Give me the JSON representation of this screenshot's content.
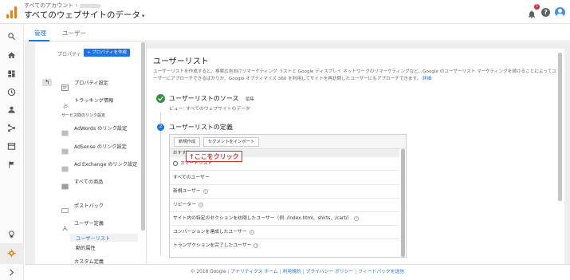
{
  "header": {
    "breadcrumb": "すべてのアカウント ›",
    "site_title": "すべてのウェブサイトのデータ",
    "caret": "▾",
    "notification_count": "1",
    "help_label": "?"
  },
  "tabs": [
    {
      "label": "管理"
    },
    {
      "label": "ユーザー"
    }
  ],
  "nav": {
    "property_label": "プロパティ",
    "create_property": "+ プロパティを作成",
    "back_label": "↰",
    "items": [
      {
        "label": "プロパティ設定"
      },
      {
        "label": "トラッキング情報"
      }
    ],
    "section_label": "サービス間のリンク設定",
    "links": [
      {
        "label": "AdWords のリンク設定"
      },
      {
        "label": "AdSense のリンク設定"
      },
      {
        "label": "Ad Exchange のリンク設定"
      },
      {
        "label": "すべての商品"
      },
      {
        "label": "ポストバック"
      },
      {
        "label": "ユーザー定義"
      }
    ],
    "sub_items": [
      {
        "label": "ユーザーリスト"
      },
      {
        "label": "動的属性"
      }
    ],
    "partial_item": "カスタム定義"
  },
  "main": {
    "title": "ユーザーリスト",
    "description": "ユーザーリストを作成すると、検索広告向けリマーケティング リストと Google ディスプレイ ネットワークのリマーケティングなど、Google のユーザーリスト マーケティングを続けることによってユーザーにアプローチできるばかりか、Google オプティマイズ 360 を利用してサイトを再訪問したユーザーにもアプローチできます。",
    "more_link": "詳細",
    "step1": {
      "title": "ユーザーリストのソース",
      "edit": "編集",
      "subtitle": "ビュー: すべてのウェブサイトのデータ"
    },
    "step2": {
      "number": "2",
      "title": "ユーザーリストの定義"
    },
    "panel_tabs": [
      {
        "label": "新規作成"
      },
      {
        "label": "セグメントをインポート"
      }
    ],
    "recommend_label": "おすすめ",
    "options": [
      {
        "label": "スマートリスト"
      },
      {
        "label": "すべてのユーザー"
      },
      {
        "label": "新規ユーザー"
      },
      {
        "label": "リピーター"
      },
      {
        "label": "サイト内の特定のセクションを訪問したユーザー（例: /index.html、shirts、/cart/）"
      },
      {
        "label": "コンバージョンを達成したユーザー"
      },
      {
        "label": "トランザクションを完了したユーザー"
      }
    ],
    "callout": "↑ここをクリック"
  },
  "footer": {
    "copyright": "© 2018 Google",
    "links": [
      {
        "label": "アナリティクス ホーム"
      },
      {
        "label": "利用規約"
      },
      {
        "label": "プライバシー ポリシー"
      },
      {
        "label": "フィードバックを送信"
      }
    ]
  },
  "colors": {
    "accent": "#1a73e8",
    "brand": "#f57c00",
    "callout": "#d32f2f",
    "success": "#388e3c"
  }
}
